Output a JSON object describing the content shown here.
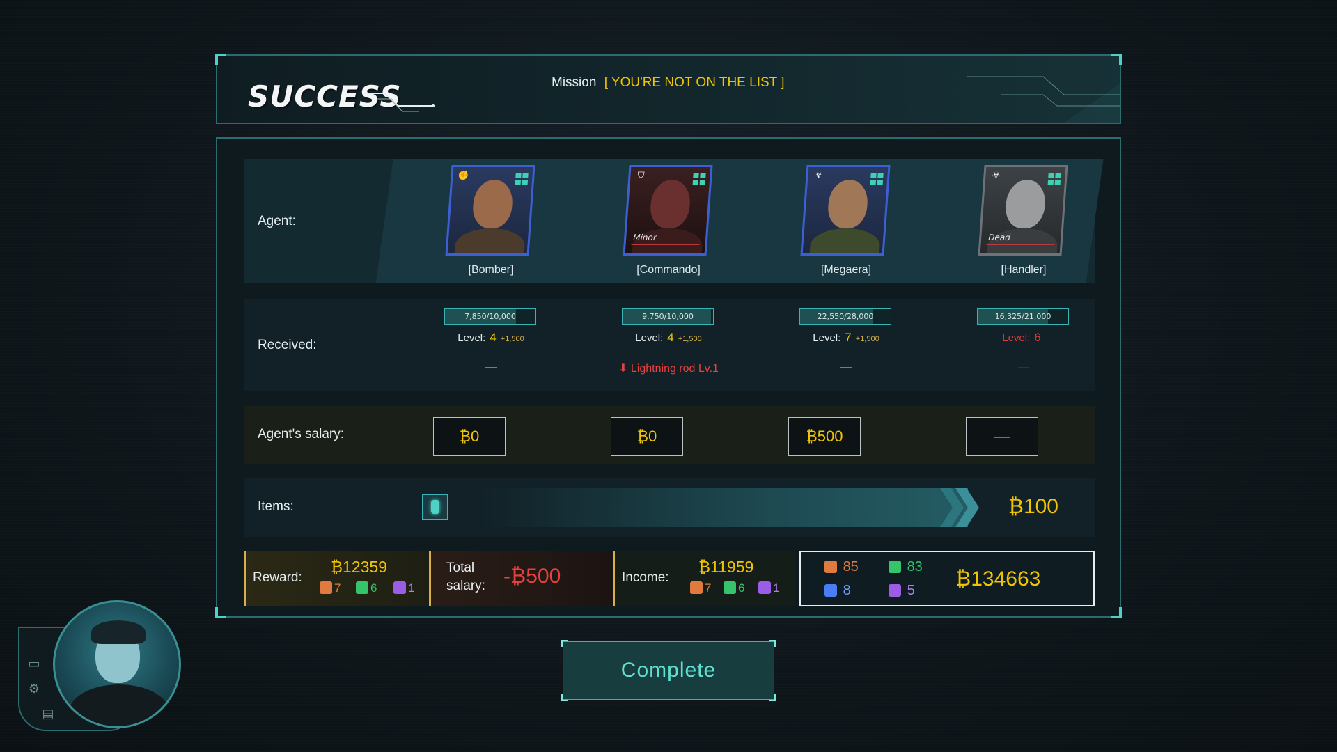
{
  "header": {
    "title": "SUCCESS",
    "mission_label": "Mission",
    "mission_name": "[ YOU'RE NOT ON THE LIST ]"
  },
  "labels": {
    "agent": "Agent:",
    "received": "Received:",
    "salary": "Agent's salary:",
    "items": "Items:",
    "reward": "Reward:",
    "total_salary_line1": "Total",
    "total_salary_line2": "salary:",
    "income": "Income:"
  },
  "agents": [
    {
      "name": "[Bomber]",
      "status": "",
      "xp": "7,850/10,000",
      "xp_fraction": 0.785,
      "level_label": "Level:",
      "level": "4",
      "bonus": "+1,500",
      "received": "—",
      "salary": "₿0",
      "portrait_icon": "fist-icon"
    },
    {
      "name": "[Commando]",
      "status": "Minor",
      "xp": "9,750/10,000",
      "xp_fraction": 0.975,
      "level_label": "Level:",
      "level": "4",
      "bonus": "+1,500",
      "received": "⬇ Lightning rod Lv.1",
      "salary": "₿0",
      "portrait_icon": "shield-icon"
    },
    {
      "name": "[Megaera]",
      "status": "",
      "xp": "22,550/28,000",
      "xp_fraction": 0.805,
      "level_label": "Level:",
      "level": "7",
      "bonus": "+1,500",
      "received": "—",
      "salary": "₿500",
      "portrait_icon": "biohazard-icon"
    },
    {
      "name": "[Handler]",
      "status": "Dead",
      "xp": "16,325/21,000",
      "xp_fraction": 0.777,
      "level_label": "Level:",
      "level": "6",
      "bonus": "",
      "received": "—",
      "salary": "—",
      "portrait_icon": "biohazard-icon"
    }
  ],
  "items": {
    "slot_icon": "battery-icon",
    "value": "₿100"
  },
  "summary": {
    "reward_money": "₿12359",
    "reward_res": [
      "7",
      "6",
      "1"
    ],
    "total_salary": "-₿500",
    "income_money": "₿11959",
    "income_res": [
      "7",
      "6",
      "1"
    ],
    "totals": {
      "orange": "85",
      "green": "83",
      "blue": "8",
      "purple": "5"
    },
    "balance": "₿134663"
  },
  "button": {
    "complete": "Complete"
  },
  "colors": {
    "accent": "#4fd1c5",
    "money": "#f0c400",
    "danger": "#e8403e",
    "agent_border": "#3c5fd3"
  }
}
